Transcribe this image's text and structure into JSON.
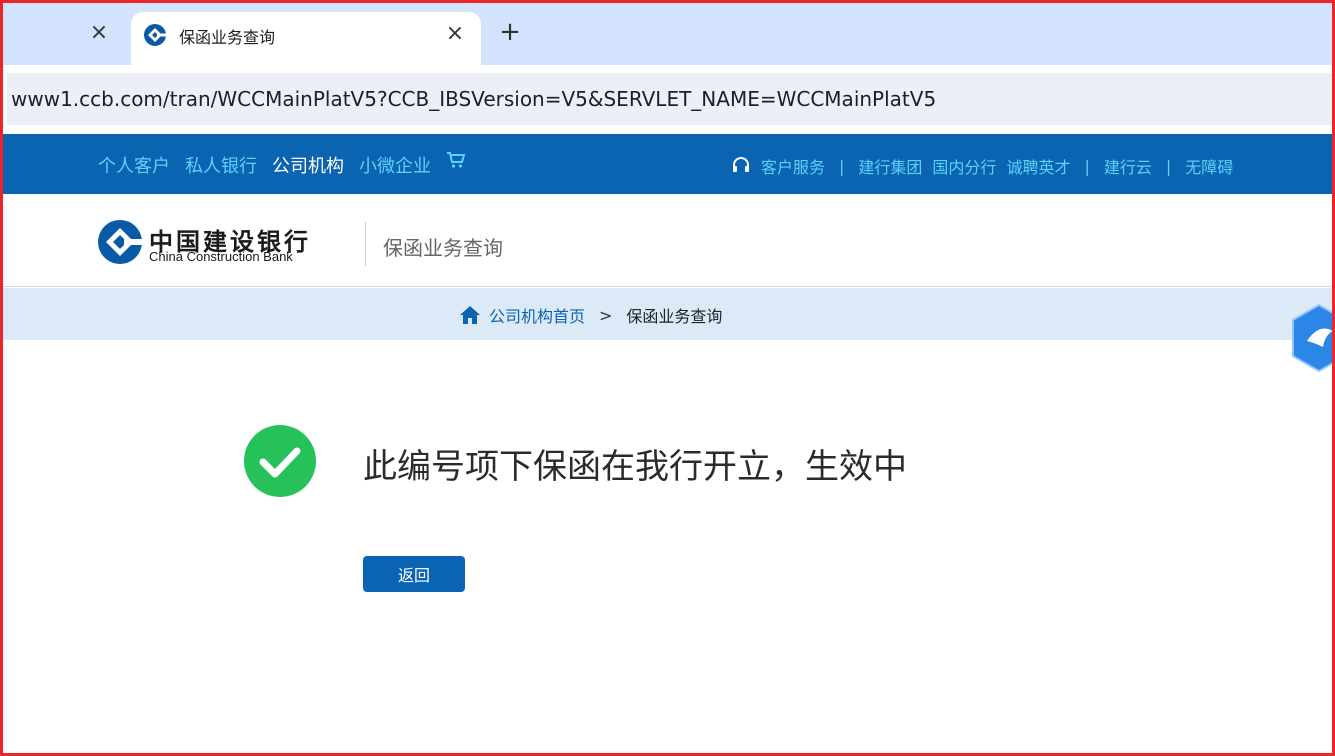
{
  "browser": {
    "prev_tab_close": "×",
    "tab": {
      "title": "保函业务查询",
      "close": "×",
      "favicon": "ccb-logo-icon"
    },
    "new_tab": "+",
    "url": "www1.ccb.com/tran/WCCMainPlatV5?CCB_IBSVersion=V5&SERVLET_NAME=WCCMainPlatV5"
  },
  "topnav": {
    "left": [
      "个人客户",
      "私人银行",
      "公司机构",
      "小微企业"
    ],
    "active_index": 2,
    "right": {
      "service": "客户服务",
      "group1": [
        "建行集团",
        "国内分行",
        "诚聘英才"
      ],
      "cloud": "建行云",
      "accessible": "无障碍"
    },
    "separator": "|"
  },
  "brand": {
    "name_cn": "中国建设银行",
    "name_en": "China Construction Bank",
    "page_title": "保函业务查询"
  },
  "breadcrumb": {
    "home": "公司机构首页",
    "separator": ">",
    "current": "保函业务查询"
  },
  "result": {
    "message": "此编号项下保函在我行开立，生效中",
    "back_label": "返回"
  },
  "colors": {
    "nav_bg": "#0b64b2",
    "nav_link": "#5fd0f7",
    "success": "#27c15a",
    "breadcrumb_bg": "#dce9f6",
    "frame_border": "#e8262b"
  }
}
